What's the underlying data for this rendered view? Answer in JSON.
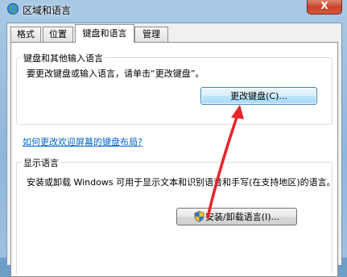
{
  "window": {
    "title": "区域和语言",
    "close_label": "X"
  },
  "tabs": [
    {
      "label": "格式"
    },
    {
      "label": "位置"
    },
    {
      "label": "键盘和语言"
    },
    {
      "label": "管理"
    }
  ],
  "keyboard_group": {
    "title": "键盘和其他输入语言",
    "description": "要更改键盘或输入语言，请单击“更改键盘”。",
    "change_button": "更改键盘(C)...",
    "welcome_link": "如何更改欢迎屏幕的键盘布局?"
  },
  "display_group": {
    "title": "显示语言",
    "description": "安装或卸载 Windows 可用于显示文本和识别语音和手写(在支持地区)的语言。",
    "install_button": "安装/卸载语言(I)..."
  },
  "annotation": {
    "arrow_color": "#e8252b"
  }
}
